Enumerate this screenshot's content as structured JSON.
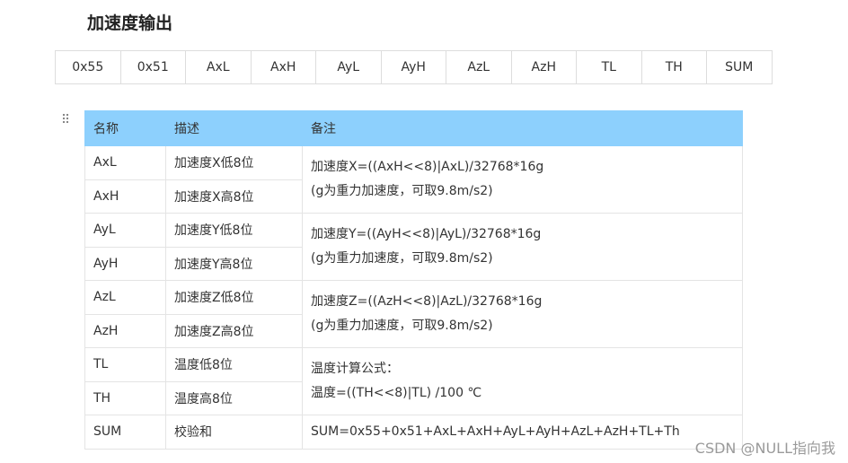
{
  "heading": "加速度输出",
  "frame_bytes": [
    "0x55",
    "0x51",
    "AxL",
    "AxH",
    "AyL",
    "AyH",
    "AzL",
    "AzH",
    "TL",
    "TH",
    "SUM"
  ],
  "spec_table": {
    "headers": [
      "名称",
      "描述",
      "备注"
    ],
    "rows": [
      {
        "name": "AxL",
        "desc": "加速度X低8位"
      },
      {
        "name": "AxH",
        "desc": "加速度X高8位"
      },
      {
        "name": "AyL",
        "desc": "加速度Y低8位"
      },
      {
        "name": "AyH",
        "desc": "加速度Y高8位"
      },
      {
        "name": "AzL",
        "desc": "加速度Z低8位"
      },
      {
        "name": "AzH",
        "desc": "加速度Z高8位"
      },
      {
        "name": "TL",
        "desc": "温度低8位"
      },
      {
        "name": "TH",
        "desc": "温度高8位"
      },
      {
        "name": "SUM",
        "desc": "校验和"
      }
    ],
    "notes": [
      {
        "line1": "加速度X=((AxH<<8)|AxL)/32768*16g",
        "line2": "(g为重力加速度，可取9.8m/s2)"
      },
      {
        "line1": "加速度Y=((AyH<<8)|AyL)/32768*16g",
        "line2": "(g为重力加速度，可取9.8m/s2)"
      },
      {
        "line1": "加速度Z=((AzH<<8)|AzL)/32768*16g",
        "line2": "(g为重力加速度，可取9.8m/s2)"
      },
      {
        "line1": "温度计算公式：",
        "line2": "温度=((TH<<8)|TL) /100 ℃"
      },
      {
        "line1": "SUM=0x55+0x51+AxL+AxH+AyL+AyH+AzL+AzH+TL+Th"
      }
    ]
  },
  "drag_handle_icon": "drag-handle-icon",
  "watermark": "CSDN @NULL指向我",
  "colors": {
    "header_bg": "#8dd0fd",
    "border": "#dddddd"
  }
}
